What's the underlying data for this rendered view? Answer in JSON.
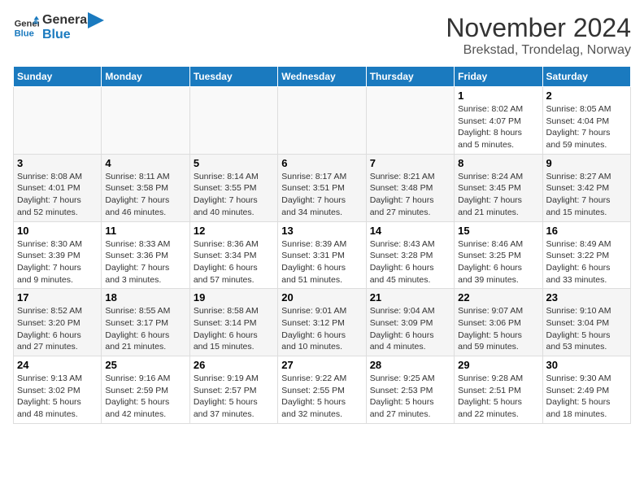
{
  "logo": {
    "line1": "General",
    "line2": "Blue"
  },
  "header": {
    "month": "November 2024",
    "location": "Brekstad, Trondelag, Norway"
  },
  "columns": [
    "Sunday",
    "Monday",
    "Tuesday",
    "Wednesday",
    "Thursday",
    "Friday",
    "Saturday"
  ],
  "weeks": [
    [
      {
        "day": "",
        "info": ""
      },
      {
        "day": "",
        "info": ""
      },
      {
        "day": "",
        "info": ""
      },
      {
        "day": "",
        "info": ""
      },
      {
        "day": "",
        "info": ""
      },
      {
        "day": "1",
        "info": "Sunrise: 8:02 AM\nSunset: 4:07 PM\nDaylight: 8 hours\nand 5 minutes."
      },
      {
        "day": "2",
        "info": "Sunrise: 8:05 AM\nSunset: 4:04 PM\nDaylight: 7 hours\nand 59 minutes."
      }
    ],
    [
      {
        "day": "3",
        "info": "Sunrise: 8:08 AM\nSunset: 4:01 PM\nDaylight: 7 hours\nand 52 minutes."
      },
      {
        "day": "4",
        "info": "Sunrise: 8:11 AM\nSunset: 3:58 PM\nDaylight: 7 hours\nand 46 minutes."
      },
      {
        "day": "5",
        "info": "Sunrise: 8:14 AM\nSunset: 3:55 PM\nDaylight: 7 hours\nand 40 minutes."
      },
      {
        "day": "6",
        "info": "Sunrise: 8:17 AM\nSunset: 3:51 PM\nDaylight: 7 hours\nand 34 minutes."
      },
      {
        "day": "7",
        "info": "Sunrise: 8:21 AM\nSunset: 3:48 PM\nDaylight: 7 hours\nand 27 minutes."
      },
      {
        "day": "8",
        "info": "Sunrise: 8:24 AM\nSunset: 3:45 PM\nDaylight: 7 hours\nand 21 minutes."
      },
      {
        "day": "9",
        "info": "Sunrise: 8:27 AM\nSunset: 3:42 PM\nDaylight: 7 hours\nand 15 minutes."
      }
    ],
    [
      {
        "day": "10",
        "info": "Sunrise: 8:30 AM\nSunset: 3:39 PM\nDaylight: 7 hours\nand 9 minutes."
      },
      {
        "day": "11",
        "info": "Sunrise: 8:33 AM\nSunset: 3:36 PM\nDaylight: 7 hours\nand 3 minutes."
      },
      {
        "day": "12",
        "info": "Sunrise: 8:36 AM\nSunset: 3:34 PM\nDaylight: 6 hours\nand 57 minutes."
      },
      {
        "day": "13",
        "info": "Sunrise: 8:39 AM\nSunset: 3:31 PM\nDaylight: 6 hours\nand 51 minutes."
      },
      {
        "day": "14",
        "info": "Sunrise: 8:43 AM\nSunset: 3:28 PM\nDaylight: 6 hours\nand 45 minutes."
      },
      {
        "day": "15",
        "info": "Sunrise: 8:46 AM\nSunset: 3:25 PM\nDaylight: 6 hours\nand 39 minutes."
      },
      {
        "day": "16",
        "info": "Sunrise: 8:49 AM\nSunset: 3:22 PM\nDaylight: 6 hours\nand 33 minutes."
      }
    ],
    [
      {
        "day": "17",
        "info": "Sunrise: 8:52 AM\nSunset: 3:20 PM\nDaylight: 6 hours\nand 27 minutes."
      },
      {
        "day": "18",
        "info": "Sunrise: 8:55 AM\nSunset: 3:17 PM\nDaylight: 6 hours\nand 21 minutes."
      },
      {
        "day": "19",
        "info": "Sunrise: 8:58 AM\nSunset: 3:14 PM\nDaylight: 6 hours\nand 15 minutes."
      },
      {
        "day": "20",
        "info": "Sunrise: 9:01 AM\nSunset: 3:12 PM\nDaylight: 6 hours\nand 10 minutes."
      },
      {
        "day": "21",
        "info": "Sunrise: 9:04 AM\nSunset: 3:09 PM\nDaylight: 6 hours\nand 4 minutes."
      },
      {
        "day": "22",
        "info": "Sunrise: 9:07 AM\nSunset: 3:06 PM\nDaylight: 5 hours\nand 59 minutes."
      },
      {
        "day": "23",
        "info": "Sunrise: 9:10 AM\nSunset: 3:04 PM\nDaylight: 5 hours\nand 53 minutes."
      }
    ],
    [
      {
        "day": "24",
        "info": "Sunrise: 9:13 AM\nSunset: 3:02 PM\nDaylight: 5 hours\nand 48 minutes."
      },
      {
        "day": "25",
        "info": "Sunrise: 9:16 AM\nSunset: 2:59 PM\nDaylight: 5 hours\nand 42 minutes."
      },
      {
        "day": "26",
        "info": "Sunrise: 9:19 AM\nSunset: 2:57 PM\nDaylight: 5 hours\nand 37 minutes."
      },
      {
        "day": "27",
        "info": "Sunrise: 9:22 AM\nSunset: 2:55 PM\nDaylight: 5 hours\nand 32 minutes."
      },
      {
        "day": "28",
        "info": "Sunrise: 9:25 AM\nSunset: 2:53 PM\nDaylight: 5 hours\nand 27 minutes."
      },
      {
        "day": "29",
        "info": "Sunrise: 9:28 AM\nSunset: 2:51 PM\nDaylight: 5 hours\nand 22 minutes."
      },
      {
        "day": "30",
        "info": "Sunrise: 9:30 AM\nSunset: 2:49 PM\nDaylight: 5 hours\nand 18 minutes."
      }
    ]
  ]
}
